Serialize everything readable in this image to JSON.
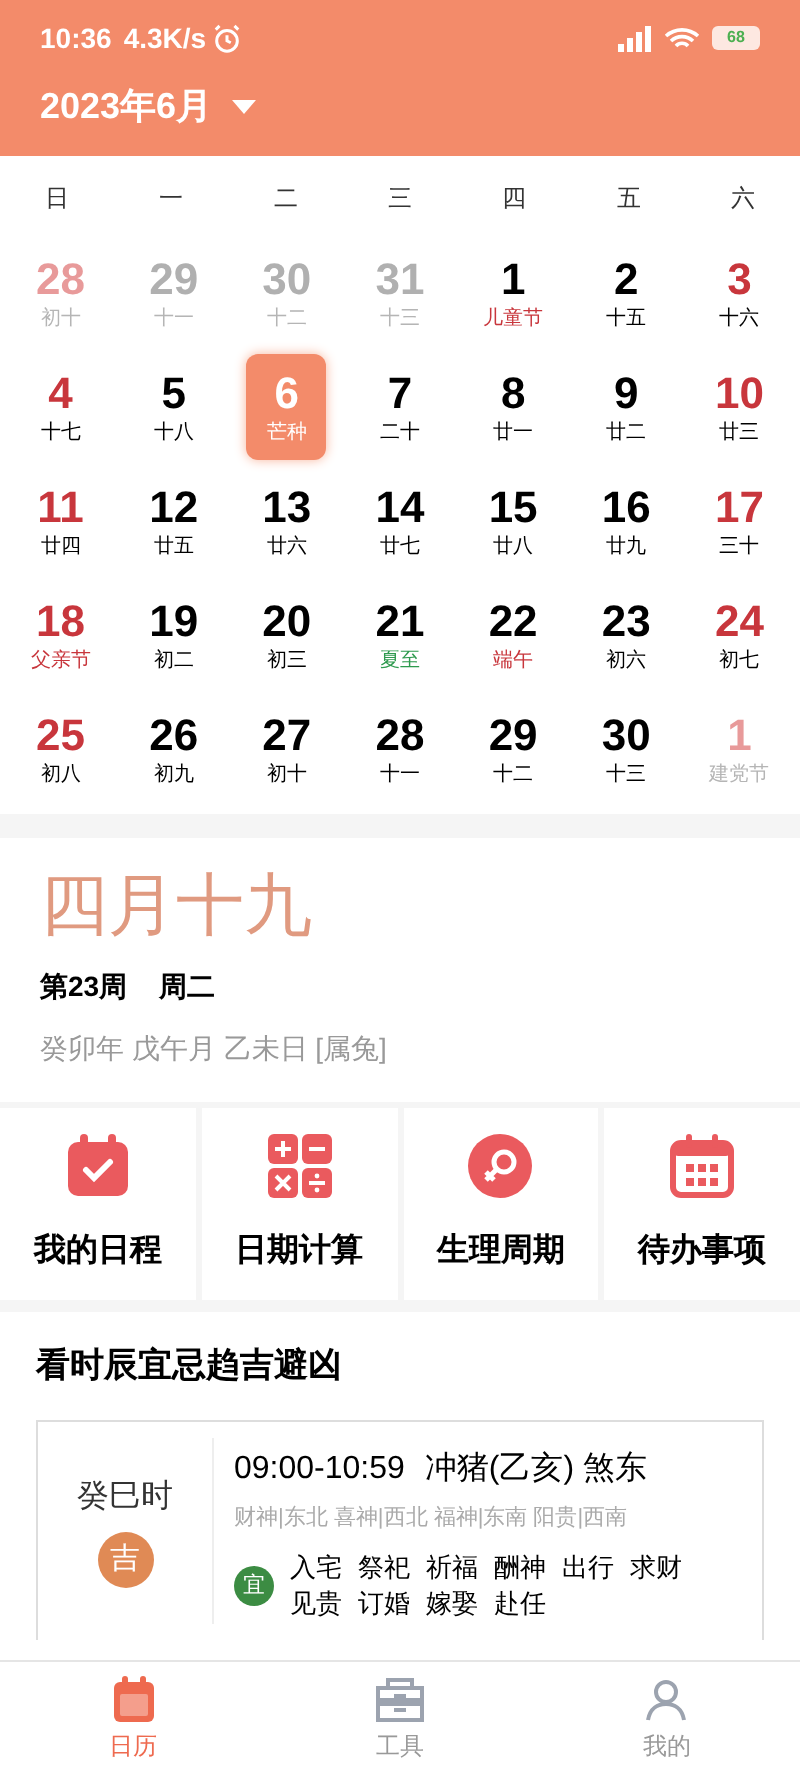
{
  "status_bar": {
    "time": "10:36",
    "speed": "4.3K/s",
    "battery": "68"
  },
  "header": {
    "title": "2023年6月"
  },
  "weekdays": [
    "日",
    "一",
    "二",
    "三",
    "四",
    "五",
    "六"
  ],
  "days": [
    {
      "day": "28",
      "lunar": "初十",
      "kind": "other_weekend",
      "color": "#b5b5b5",
      "selected": false
    },
    {
      "day": "29",
      "lunar": "十一",
      "kind": "other",
      "color": "#b5b5b5",
      "selected": false
    },
    {
      "day": "30",
      "lunar": "十二",
      "kind": "other",
      "color": "#b5b5b5",
      "selected": false
    },
    {
      "day": "31",
      "lunar": "十三",
      "kind": "other",
      "color": "#b5b5b5",
      "selected": false
    },
    {
      "day": "1",
      "lunar": "儿童节",
      "kind": "weekday",
      "color": "#c8363c",
      "selected": false
    },
    {
      "day": "2",
      "lunar": "十五",
      "kind": "weekday",
      "color": "#000000",
      "selected": false
    },
    {
      "day": "3",
      "lunar": "十六",
      "kind": "weekend",
      "color": "#000000",
      "selected": false
    },
    {
      "day": "4",
      "lunar": "十七",
      "kind": "weekend",
      "color": "#000000",
      "selected": false
    },
    {
      "day": "5",
      "lunar": "十八",
      "kind": "weekday",
      "color": "#000000",
      "selected": false
    },
    {
      "day": "6",
      "lunar": "芒种",
      "kind": "weekday",
      "color": "#ffffff",
      "selected": true
    },
    {
      "day": "7",
      "lunar": "二十",
      "kind": "weekday",
      "color": "#000000",
      "selected": false
    },
    {
      "day": "8",
      "lunar": "廿一",
      "kind": "weekday",
      "color": "#000000",
      "selected": false
    },
    {
      "day": "9",
      "lunar": "廿二",
      "kind": "weekday",
      "color": "#000000",
      "selected": false
    },
    {
      "day": "10",
      "lunar": "廿三",
      "kind": "weekend",
      "color": "#000000",
      "selected": false
    },
    {
      "day": "11",
      "lunar": "廿四",
      "kind": "weekend",
      "color": "#000000",
      "selected": false
    },
    {
      "day": "12",
      "lunar": "廿五",
      "kind": "weekday",
      "color": "#000000",
      "selected": false
    },
    {
      "day": "13",
      "lunar": "廿六",
      "kind": "weekday",
      "color": "#000000",
      "selected": false
    },
    {
      "day": "14",
      "lunar": "廿七",
      "kind": "weekday",
      "color": "#000000",
      "selected": false
    },
    {
      "day": "15",
      "lunar": "廿八",
      "kind": "weekday",
      "color": "#000000",
      "selected": false
    },
    {
      "day": "16",
      "lunar": "廿九",
      "kind": "weekday",
      "color": "#000000",
      "selected": false
    },
    {
      "day": "17",
      "lunar": "三十",
      "kind": "weekend",
      "color": "#000000",
      "selected": false
    },
    {
      "day": "18",
      "lunar": "父亲节",
      "kind": "weekend",
      "color": "#c8363c",
      "selected": false
    },
    {
      "day": "19",
      "lunar": "初二",
      "kind": "weekday",
      "color": "#000000",
      "selected": false
    },
    {
      "day": "20",
      "lunar": "初三",
      "kind": "weekday",
      "color": "#000000",
      "selected": false
    },
    {
      "day": "21",
      "lunar": "夏至",
      "kind": "weekday",
      "color": "#2e9a4e",
      "selected": false
    },
    {
      "day": "22",
      "lunar": "端午",
      "kind": "weekday",
      "color": "#c8363c",
      "selected": false
    },
    {
      "day": "23",
      "lunar": "初六",
      "kind": "weekday",
      "color": "#000000",
      "selected": false
    },
    {
      "day": "24",
      "lunar": "初七",
      "kind": "weekend",
      "color": "#000000",
      "selected": false
    },
    {
      "day": "25",
      "lunar": "初八",
      "kind": "weekend",
      "color": "#000000",
      "selected": false
    },
    {
      "day": "26",
      "lunar": "初九",
      "kind": "weekday",
      "color": "#000000",
      "selected": false
    },
    {
      "day": "27",
      "lunar": "初十",
      "kind": "weekday",
      "color": "#000000",
      "selected": false
    },
    {
      "day": "28",
      "lunar": "十一",
      "kind": "weekday",
      "color": "#000000",
      "selected": false
    },
    {
      "day": "29",
      "lunar": "十二",
      "kind": "weekday",
      "color": "#000000",
      "selected": false
    },
    {
      "day": "30",
      "lunar": "十三",
      "kind": "weekday",
      "color": "#000000",
      "selected": false
    },
    {
      "day": "1",
      "lunar": "建党节",
      "kind": "other_weekend",
      "color": "#b5b5b5",
      "selected": false
    }
  ],
  "lunar_info": {
    "date": "四月十九",
    "week": "第23周",
    "weekday": "周二",
    "ganzhi": "癸卯年 戊午月 乙未日 [属兔]"
  },
  "tools": [
    {
      "label": "我的日程",
      "kind": "schedule"
    },
    {
      "label": "日期计算",
      "kind": "calculator"
    },
    {
      "label": "生理周期",
      "kind": "cycle"
    },
    {
      "label": "待办事项",
      "kind": "todo"
    }
  ],
  "hour_section": {
    "title": "看时辰宜忌趋吉避凶",
    "hour": "癸巳时",
    "luck": "吉",
    "time": "09:00-10:59",
    "clash": "冲猪(乙亥) 煞东",
    "gods": "财神|东北 喜神|西北 福神|东南 阳贵|西南",
    "yi_label": "宜",
    "yi": [
      "入宅",
      "祭祀",
      "祈福",
      "酬神",
      "出行",
      "求财",
      "见贵",
      "订婚",
      "嫁娶",
      "赴任"
    ]
  },
  "bottom_nav": [
    {
      "label": "日历",
      "kind": "calendar",
      "selected": true
    },
    {
      "label": "工具",
      "kind": "tools",
      "selected": false
    },
    {
      "label": "我的",
      "kind": "profile",
      "selected": false
    }
  ]
}
